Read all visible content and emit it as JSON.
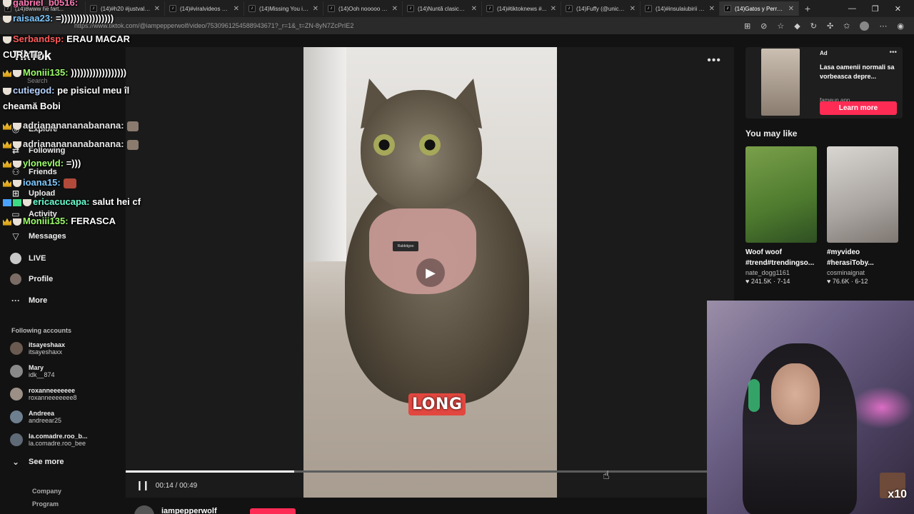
{
  "browser": {
    "tabs": [
      {
        "title": "(14)Ȣwww he fart..."
      },
      {
        "title": "(14)#h20 #justvalen..."
      },
      {
        "title": "(14)#viralvideos #co..."
      },
      {
        "title": "(14)Missing You is..."
      },
      {
        "title": "(14)Ooh nooooo #..."
      },
      {
        "title": "(14)Nuntă clasică?..."
      },
      {
        "title": "(14)#tiktoknews #..."
      },
      {
        "title": "(14)Fuffy (@unicor..."
      },
      {
        "title": "(14)#insulaiubirii #..."
      },
      {
        "title": "(14)Gatos y Perros..."
      }
    ],
    "new_tab": "+",
    "url": "https://www.tiktok.com/@iampepperwolf/video/7530961254588943671?_r=1&_t=ZN-8yN7ZcPrIE2",
    "window_controls": [
      "—",
      "❐",
      "✕"
    ]
  },
  "sidebar": {
    "logo": "TikTok",
    "search_placeholder": "Search",
    "nav": [
      {
        "label": "Explore",
        "icon": "compass-icon"
      },
      {
        "label": "Following",
        "icon": "following-icon"
      },
      {
        "label": "Friends",
        "icon": "friends-icon"
      },
      {
        "label": "Upload",
        "icon": "upload-icon"
      },
      {
        "label": "Activity",
        "icon": "activity-icon"
      },
      {
        "label": "Messages",
        "icon": "messages-icon"
      },
      {
        "label": "LIVE",
        "icon": "live-icon"
      },
      {
        "label": "Profile",
        "icon": "profile-icon"
      },
      {
        "label": "More",
        "icon": "more-icon"
      }
    ],
    "following_title": "Following accounts",
    "accounts": [
      {
        "name": "itsayeshaax",
        "handle": "itsayeshaxx"
      },
      {
        "name": "Mary",
        "handle": "idk__874"
      },
      {
        "name": "roxanneeeeeee",
        "handle": "roxanneeeeeee8"
      },
      {
        "name": "Andreea",
        "handle": "andreear25"
      },
      {
        "name": "la.comadre.roo_b...",
        "handle": "la.comadre.roo_bee"
      }
    ],
    "see_more": "See more",
    "footer": [
      "Company",
      "Program"
    ]
  },
  "chat": [
    {
      "user": "gabriel_b0516:",
      "msg": "",
      "color": "#ff7ab6"
    },
    {
      "user": "raisaa23:",
      "msg": "=)))))))))))))))))",
      "color": "#7fc8ff"
    },
    {
      "user": "Serbandsp:",
      "msg": "ERAU MACAR CURATI?",
      "color": "#ff5b5b"
    },
    {
      "user": "Moniii135:",
      "msg": "))))))))))))))))))",
      "color": "#9dff6a"
    },
    {
      "user": "cutiegod:",
      "msg": "pe pisicul meu îl cheamă Bobi",
      "color": "#b7d3ff"
    },
    {
      "user": "adriananananabanana:",
      "msg": "",
      "color": "#e6e6e6"
    },
    {
      "user": "adriananananabanana:",
      "msg": "",
      "color": "#e6e6e6"
    },
    {
      "user": "ylonevld:",
      "msg": "=)))",
      "color": "#9dff6a"
    },
    {
      "user": "ioana15:",
      "msg": "",
      "color": "#7fc8ff"
    },
    {
      "user": "ericacucapa:",
      "msg": "salut hei cf",
      "color": "#6affd0"
    },
    {
      "user": "Moniii135:",
      "msg": "FERASCA",
      "color": "#9dff6a"
    }
  ],
  "video": {
    "caption": "LONG",
    "harness_tag": "Rabbitgoo",
    "time_current": "00:14",
    "time_total": "00:49",
    "progress": 0.29,
    "author": "iampepperwolf"
  },
  "right": {
    "ad_label": "Ad",
    "ad_text": "Lasa oamenii normali sa vorbeasca depre...",
    "ad_domain": "fameup.app",
    "learn_more": "Learn more",
    "you_may_like": "You may like",
    "recs": [
      {
        "title": "Woof woof #trend#trendingso...",
        "author": "nate_dogg1161",
        "stats": "♥ 241.5K · 7-14"
      },
      {
        "title": "#myvideo #herasiToby...",
        "author": "cosminaignat",
        "stats": "♥ 76.6K · 6-12"
      }
    ]
  },
  "webcam": {
    "multiplier": "x10"
  },
  "colors": {
    "accent": "#fe2c55"
  }
}
